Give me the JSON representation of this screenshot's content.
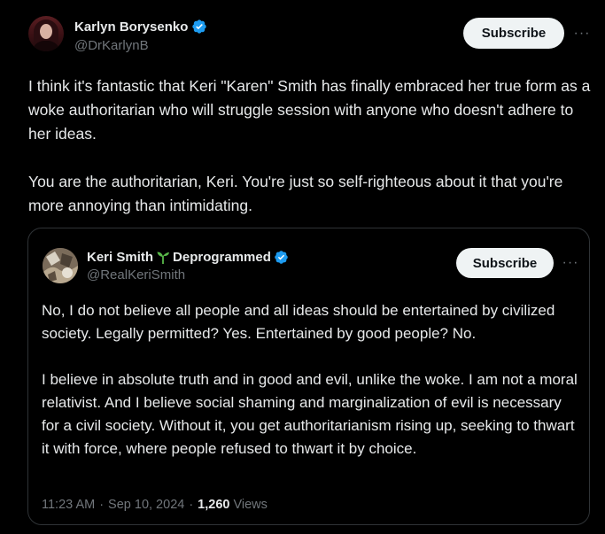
{
  "post": {
    "author": {
      "name": "Karlyn Borysenko",
      "handle": "@DrKarlynB"
    },
    "subscribe_label": "Subscribe",
    "more_label": "···",
    "paragraphs": [
      "I think it's fantastic that Keri \"Karen\" Smith has finally embraced her true form as a woke authoritarian who will struggle session with anyone who doesn't adhere to her ideas.",
      "You are the authoritarian, Keri. You're just so self-righteous about it that you're more annoying than intimidating."
    ]
  },
  "quote": {
    "author": {
      "name": "Keri Smith",
      "name_suffix": "Deprogrammed",
      "handle": "@RealKeriSmith"
    },
    "subscribe_label": "Subscribe",
    "more_label": "···",
    "paragraphs": [
      "No, I do not believe all people and all ideas should be entertained by civilized society. Legally permitted? Yes. Entertained by good people? No.",
      "I believe in absolute truth and in good and evil, unlike the woke. I am not a moral relativist. And I believe social shaming and marginalization of evil is necessary for a civil society. Without it, you get authoritarianism rising up, seeking to thwart it with force, where people refused to thwart it by choice."
    ],
    "meta": {
      "time": "11:23 AM",
      "separator": "·",
      "date": "Sep 10, 2024",
      "views_count": "1,260",
      "views_label": "Views"
    }
  },
  "icons": {
    "verified": "verified-badge-icon",
    "sprout": "seedling-icon",
    "more": "more-horizontal-icon"
  },
  "colors": {
    "background": "#000000",
    "text": "#e7e9ea",
    "secondary_text": "#71767b",
    "border": "#2f3336",
    "verified": "#1d9bf0",
    "button_bg": "#eff3f4",
    "button_text": "#0f1419",
    "sprout": "#59b84a"
  }
}
